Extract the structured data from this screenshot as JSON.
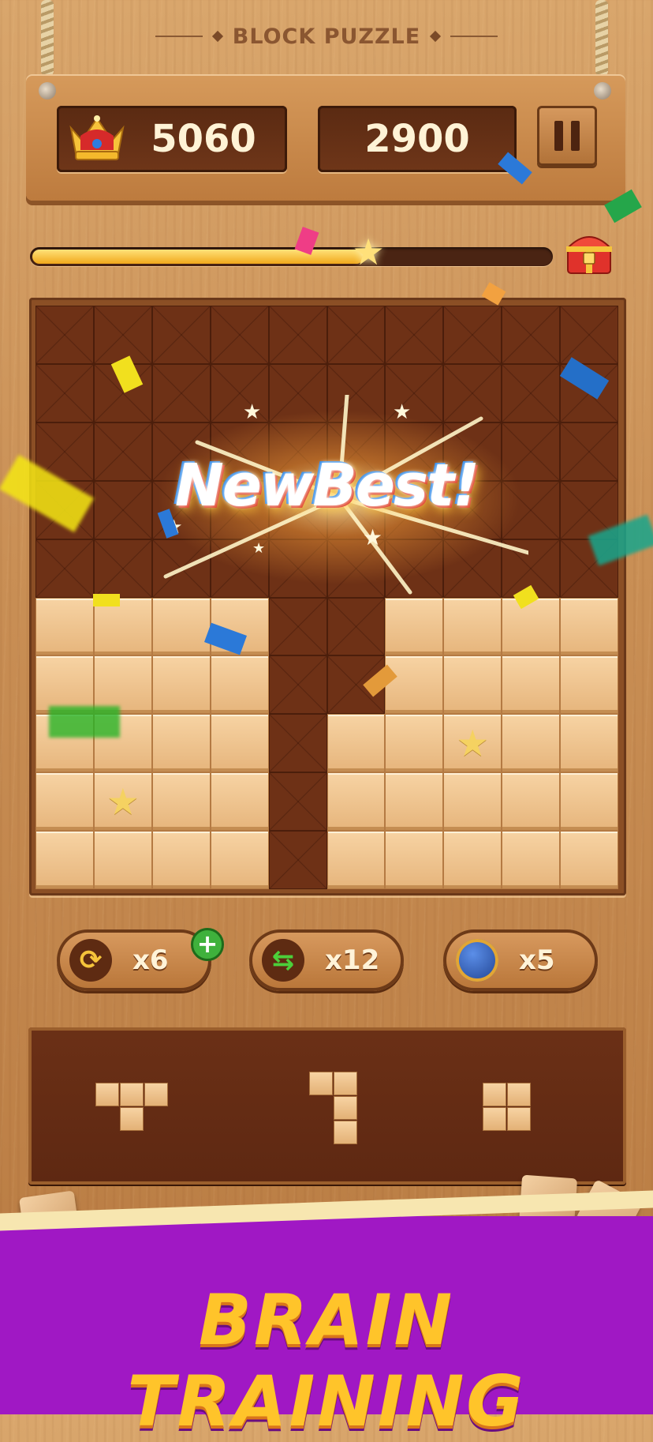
{
  "title": "BLOCK PUZZLE",
  "header": {
    "best_score": "5060",
    "current_score": "2900"
  },
  "progress": {
    "fraction": 0.64
  },
  "new_best_label": "NewBest!",
  "board": {
    "rows": [
      "0000000000",
      "0000000000",
      "0000000000",
      "0000000000",
      "0000000000",
      "1111001111",
      "1111001111",
      "1111011111",
      "1111011111",
      "1111011111"
    ],
    "stars": [
      [
        7,
        7
      ],
      [
        8,
        1
      ]
    ]
  },
  "powerups": [
    {
      "name": "rotate",
      "count": "x6",
      "icon": "rotate-icon"
    },
    {
      "name": "swap",
      "count": "x12",
      "icon": "swap-icon"
    },
    {
      "name": "bomb",
      "count": "x5",
      "icon": "bomb-icon"
    }
  ],
  "tray_pieces": [
    {
      "name": "t-piece",
      "cells": [
        [
          0,
          0
        ],
        [
          0,
          1
        ],
        [
          0,
          2
        ],
        [
          1,
          1
        ]
      ]
    },
    {
      "name": "j-piece",
      "cells": [
        [
          0,
          0
        ],
        [
          0,
          1
        ],
        [
          1,
          1
        ],
        [
          2,
          1
        ]
      ]
    },
    {
      "name": "square-piece",
      "cells": [
        [
          0,
          0
        ],
        [
          0,
          1
        ],
        [
          1,
          0
        ],
        [
          1,
          1
        ]
      ]
    }
  ],
  "banner_text": "BRAIN TRAINING",
  "colors": {
    "banner": "#a018c4",
    "banner_text": "#ffc42a",
    "empty_cell": "#6e3116",
    "filled_cell": "#e6b57c"
  }
}
